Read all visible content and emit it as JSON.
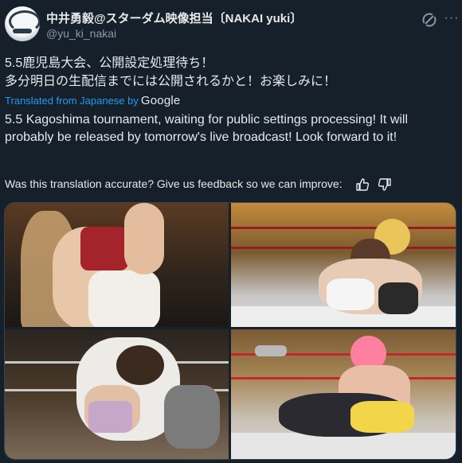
{
  "post": {
    "display_name": "中井勇毅@スターダム映像担当〔NAKAI yuki〕",
    "handle": "@yu_ki_nakai",
    "original_lines": [
      "5.5鹿児島大会、公開設定処理待ち！",
      "多分明日の生配信までには公開されるかと！お楽しみに！"
    ],
    "translated_from": "Translated from Japanese by",
    "translator": "Google",
    "translation": "5.5 Kagoshima tournament, waiting for public settings processing! It will probably be released by tomorrow's live broadcast! Look forward to it!",
    "feedback_prompt": "Was this translation accurate? Give us feedback so we can improve:",
    "more_label": "···"
  },
  "media": {
    "photos": [
      {
        "icon": "photo-wrestler-closeup"
      },
      {
        "icon": "photo-ring-submission"
      },
      {
        "icon": "photo-ring-grapple"
      },
      {
        "icon": "photo-ring-pin"
      }
    ]
  },
  "colors": {
    "background": "#15202b",
    "text": "#e7e9ea",
    "secondary": "#8b98a5",
    "link": "#1d9bf0"
  }
}
